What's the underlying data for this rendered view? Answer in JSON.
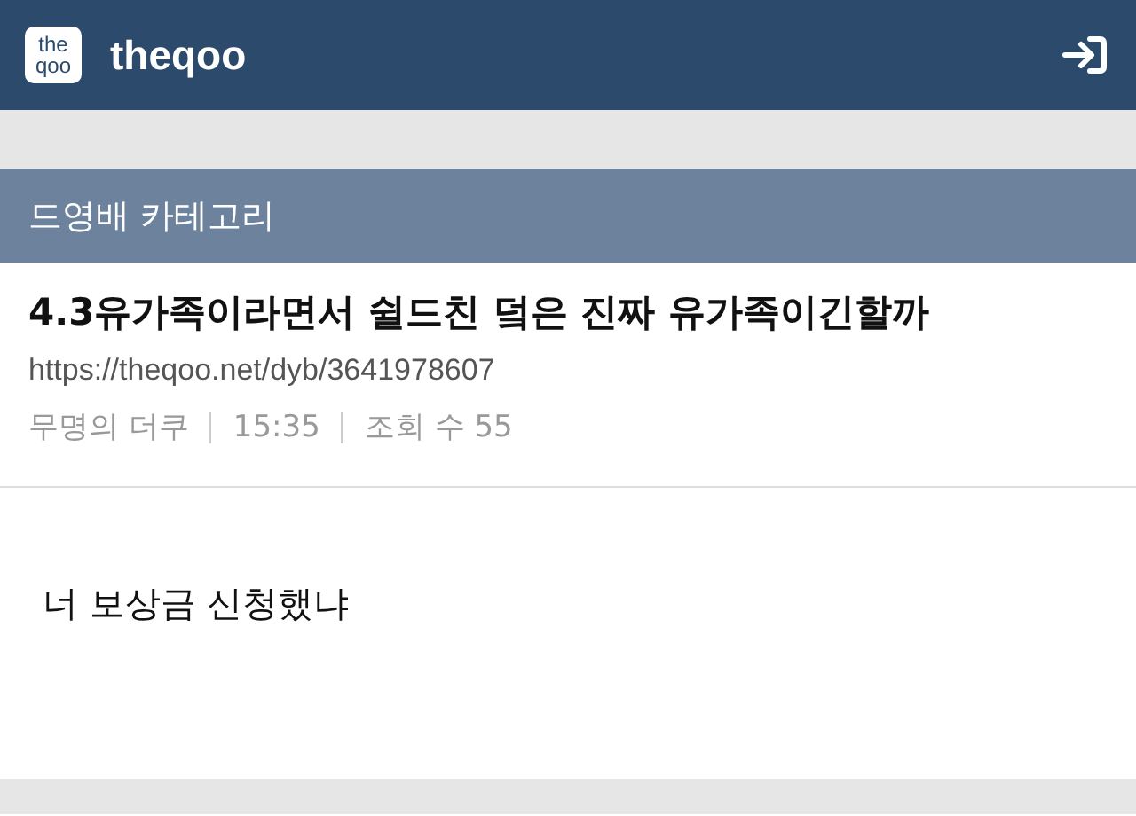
{
  "header": {
    "logo_lines": [
      "the",
      "qoo"
    ],
    "site_name": "theqoo"
  },
  "category": {
    "label": "드영배 카테고리"
  },
  "post": {
    "title": "4.3유가족이라면서 쉴드친 덬은 진짜 유가족이긴할까",
    "url": "https://theqoo.net/dyb/3641978607",
    "meta": [
      "무명의 더쿠",
      "15:35",
      "조회 수 55"
    ],
    "body": "너 보상금 신청했냐"
  }
}
